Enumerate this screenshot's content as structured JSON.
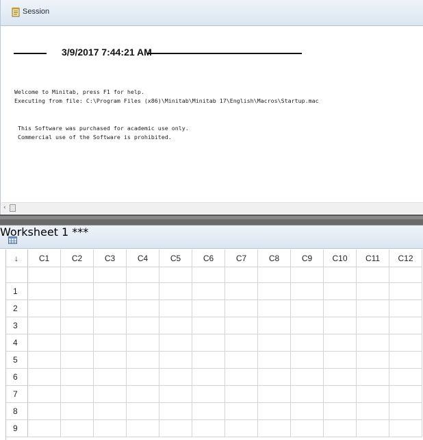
{
  "session": {
    "title": "Session",
    "datetime": "3/9/2017 7:44:21 AM",
    "lines": [
      "Welcome to Minitab, press F1 for help.",
      "Executing from file: C:\\Program Files (x86)\\Minitab\\Minitab 17\\English\\Macros\\Startup.mac",
      " This Software was purchased for academic use only.",
      " Commercial use of the Software is prohibited."
    ]
  },
  "worksheet": {
    "title": "Worksheet 1 ***",
    "corner_glyph": "↓",
    "columns": [
      "C1",
      "C2",
      "C3",
      "C4",
      "C5",
      "C6",
      "C7",
      "C8",
      "C9",
      "C10",
      "C11",
      "C12"
    ],
    "rows": [
      "1",
      "2",
      "3",
      "4",
      "5",
      "6",
      "7",
      "8",
      "9"
    ]
  },
  "icons": {
    "session": "session-notepad-icon",
    "worksheet": "worksheet-grid-icon",
    "scroll_left": "scroll-left-arrow-icon"
  }
}
